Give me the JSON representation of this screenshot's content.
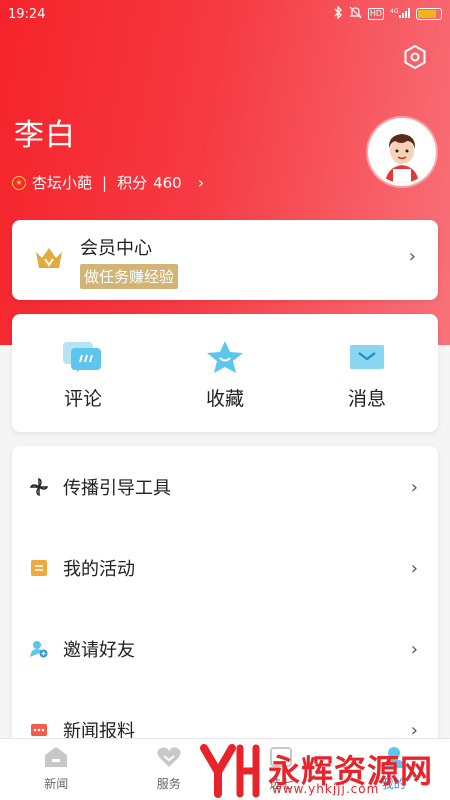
{
  "status_bar": {
    "time": "19:24",
    "network": "4G",
    "hd": "HD"
  },
  "user": {
    "name": "李白",
    "level": "杏坛小葩",
    "points_label": "积分",
    "points": "460"
  },
  "vip": {
    "title": "会员中心",
    "subtitle": "做任务赚经验"
  },
  "quick_actions": [
    {
      "label": "评论",
      "icon": "comment-icon"
    },
    {
      "label": "收藏",
      "icon": "favorite-icon"
    },
    {
      "label": "消息",
      "icon": "message-icon"
    }
  ],
  "menu": [
    {
      "label": "传播引导工具",
      "icon": "pinwheel-icon"
    },
    {
      "label": "我的活动",
      "icon": "activity-icon"
    },
    {
      "label": "邀请好友",
      "icon": "invite-friend-icon"
    },
    {
      "label": "新闻报料",
      "icon": "news-report-icon"
    }
  ],
  "bottom_nav": [
    {
      "label": "新闻",
      "icon": "home-icon"
    },
    {
      "label": "服务",
      "icon": "heart-icon"
    },
    {
      "label": "选七",
      "icon": "choose-icon"
    },
    {
      "label": "我的",
      "icon": "profile-icon"
    }
  ],
  "watermark": {
    "text": "永辉资源网",
    "url": "www.yhkjjj.com"
  },
  "colors": {
    "brand_red": "#f5232a",
    "gold": "#d3b477",
    "accent_blue": "#3a8fd8"
  }
}
